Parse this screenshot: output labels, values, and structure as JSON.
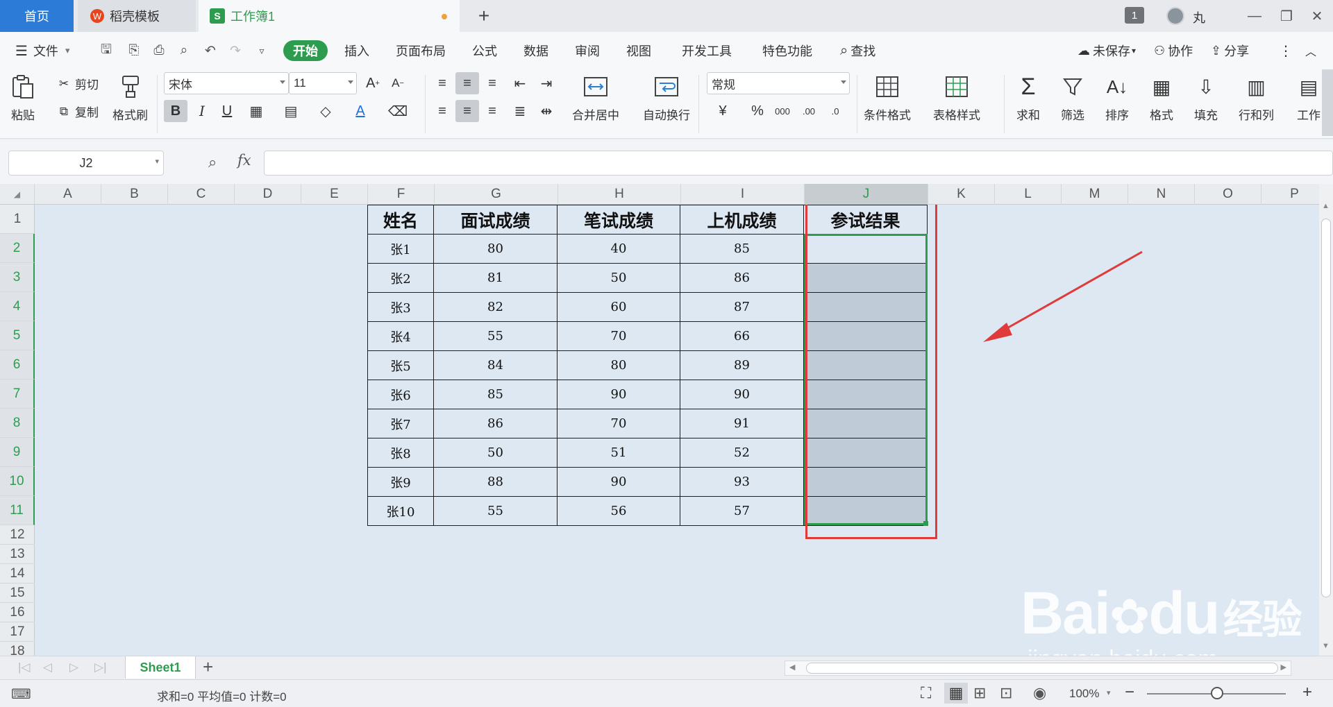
{
  "tabs": {
    "home": "首页",
    "docer": "稻壳模板",
    "workbook": "工作簿1",
    "workbook_icon": "S",
    "docer_icon": "W",
    "badge_count": "1",
    "user": "丸"
  },
  "menu": {
    "file": "文件",
    "items": [
      "开始",
      "插入",
      "页面布局",
      "公式",
      "数据",
      "审阅",
      "视图",
      "开发工具",
      "特色功能"
    ],
    "search": "查找",
    "unsaved": "未保存",
    "collab": "协作",
    "share": "分享"
  },
  "ribbon": {
    "paste": "粘贴",
    "cut": "剪切",
    "copy": "复制",
    "format_painter": "格式刷",
    "font_name": "宋体",
    "font_size": "11",
    "bold": "B",
    "italic": "I",
    "underline": "U",
    "merge_center": "合并居中",
    "wrap": "自动换行",
    "number_format": "常规",
    "conditional": "条件格式",
    "table_style": "表格样式",
    "sum": "求和",
    "filter": "筛选",
    "sort": "排序",
    "format": "格式",
    "fill": "填充",
    "rowcol": "行和列",
    "worksheet": "工作"
  },
  "formula_bar": {
    "cell_ref": "J2",
    "fx": "fx",
    "value": ""
  },
  "columns": [
    "A",
    "B",
    "C",
    "D",
    "E",
    "F",
    "G",
    "H",
    "I",
    "J",
    "K",
    "L",
    "M",
    "N",
    "O",
    "P"
  ],
  "rows": [
    "1",
    "2",
    "3",
    "4",
    "5",
    "6",
    "7",
    "8",
    "9",
    "10",
    "11",
    "12",
    "13",
    "14",
    "15",
    "16",
    "17",
    "18"
  ],
  "table": {
    "headers": [
      "姓名",
      "面试成绩",
      "笔试成绩",
      "上机成绩",
      "参试结果"
    ],
    "rows": [
      [
        "张1",
        "80",
        "40",
        "85",
        ""
      ],
      [
        "张2",
        "81",
        "50",
        "86",
        ""
      ],
      [
        "张3",
        "82",
        "60",
        "87",
        ""
      ],
      [
        "张4",
        "55",
        "70",
        "66",
        ""
      ],
      [
        "张5",
        "84",
        "80",
        "89",
        ""
      ],
      [
        "张6",
        "85",
        "90",
        "90",
        ""
      ],
      [
        "张7",
        "86",
        "70",
        "91",
        ""
      ],
      [
        "张8",
        "50",
        "51",
        "52",
        ""
      ],
      [
        "张9",
        "88",
        "90",
        "93",
        ""
      ],
      [
        "张10",
        "55",
        "56",
        "57",
        ""
      ]
    ]
  },
  "sheet": {
    "name": "Sheet1"
  },
  "status": {
    "summary": "求和=0  平均值=0  计数=0",
    "zoom": "100%"
  },
  "watermark": {
    "brand": "Bai",
    "brand2": "du",
    "suffix": "经验",
    "url": "jingyan.baidu.com"
  },
  "colors": {
    "accent": "#2e9c4f",
    "highlight_box": "#e03a3a",
    "home_tab": "#2c7bd6"
  }
}
